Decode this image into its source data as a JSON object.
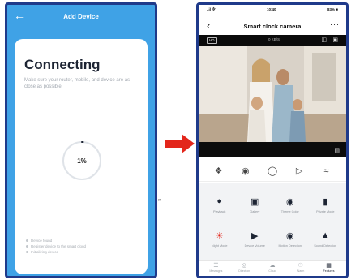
{
  "left_phone": {
    "header": {
      "back_icon": "arrow-left-icon",
      "title": "Add Device"
    },
    "card": {
      "heading": "Connecting",
      "description": "Make sure your router, mobile, and device are as close as possible",
      "progress_percent": 1,
      "progress_label": "1%",
      "steps": [
        "Device found",
        "Register device to the smart cloud",
        "Initializing device"
      ]
    }
  },
  "chevrons": "»",
  "arrow": {
    "color": "#e3261b"
  },
  "right_phone": {
    "status_bar": {
      "left": "..il 令",
      "time": "10:40",
      "right": "83% ■"
    },
    "header": {
      "back_icon": "chevron-left-icon",
      "title": "Smart clock camera",
      "more_icon": "more-icon"
    },
    "video": {
      "hd_badge": "HD",
      "speed": "0 KB/S"
    },
    "controls": [
      "screenshot-icon",
      "camera-icon",
      "microphone-icon",
      "record-icon",
      "speaker-icon"
    ],
    "features": [
      {
        "icon": "playback-icon",
        "label": "Playback"
      },
      {
        "icon": "gallery-icon",
        "label": "Gallery"
      },
      {
        "icon": "theme-color-icon",
        "label": "Theme Color"
      },
      {
        "icon": "private-mode-icon",
        "label": "Private Mode"
      },
      {
        "icon": "night-mode-icon",
        "label": "Night Mode"
      },
      {
        "icon": "device-volume-icon",
        "label": "Device Volume"
      },
      {
        "icon": "motion-detection-icon",
        "label": "Motion Detection"
      },
      {
        "icon": "sound-detection-icon",
        "label": "Sound Detection"
      }
    ],
    "tabs": [
      {
        "icon": "messages-icon",
        "label": "Messages",
        "active": false
      },
      {
        "icon": "direction-icon",
        "label": "Direction",
        "active": false
      },
      {
        "icon": "cloud-icon",
        "label": "Cloud",
        "active": false
      },
      {
        "icon": "alarm-icon",
        "label": "Alarm",
        "active": false
      },
      {
        "icon": "features-icon",
        "label": "Features",
        "active": true
      }
    ]
  },
  "colors": {
    "left_bg": "#3fa2e6",
    "frame": "#1f3a8a",
    "grid_bg": "#f2f3f5"
  }
}
